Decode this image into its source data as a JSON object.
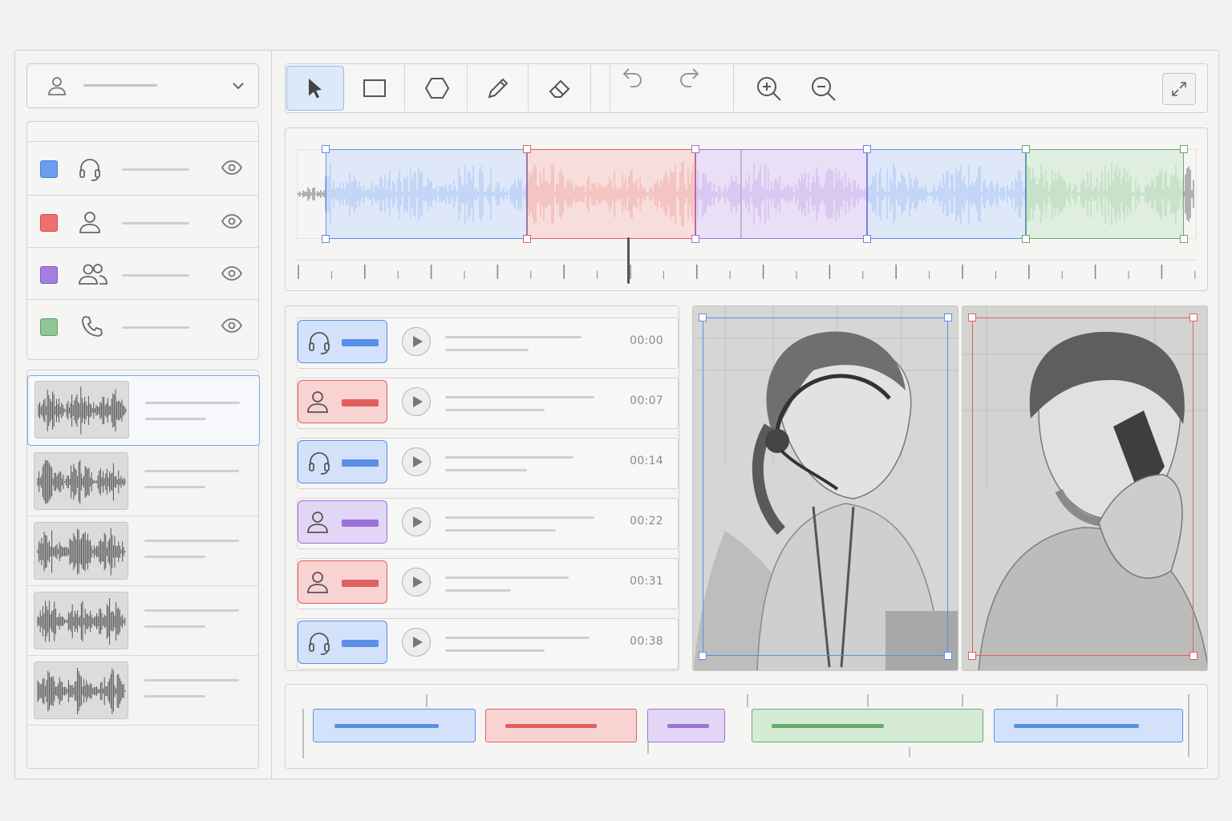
{
  "colors": {
    "agent": "#5b8ee6",
    "customer": "#e06060",
    "group": "#9b72d8",
    "phone": "#6aaa6e"
  },
  "sidebar": {
    "user_select_icon": "user-icon",
    "labels": [
      {
        "color": "#5b8ee6",
        "icon": "headset-icon"
      },
      {
        "color": "#e06060",
        "icon": "user-icon"
      },
      {
        "color": "#9b72d8",
        "icon": "users-icon"
      },
      {
        "color": "#6aaa6e",
        "icon": "phone-icon"
      }
    ],
    "clips_count_shown": 5
  },
  "toolbar": {
    "tools": [
      "select-tool",
      "rectangle-tool",
      "polygon-tool",
      "pencil-tool",
      "eraser-tool",
      "undo",
      "redo",
      "zoom-in",
      "zoom-out",
      "expand"
    ]
  },
  "segments": [
    {
      "speaker": "agent",
      "icon": "headset-icon",
      "time": "00:00"
    },
    {
      "speaker": "customer",
      "icon": "user-icon",
      "time": "00:07"
    },
    {
      "speaker": "agent",
      "icon": "headset-icon",
      "time": "00:14"
    },
    {
      "speaker": "group",
      "icon": "user-icon",
      "time": "00:22"
    },
    {
      "speaker": "customer",
      "icon": "user-icon",
      "time": "00:31"
    },
    {
      "speaker": "agent",
      "icon": "headset-icon",
      "time": "00:38"
    }
  ],
  "timeline_blocks": [
    "agent",
    "customer",
    "group",
    "phone",
    "agent"
  ]
}
